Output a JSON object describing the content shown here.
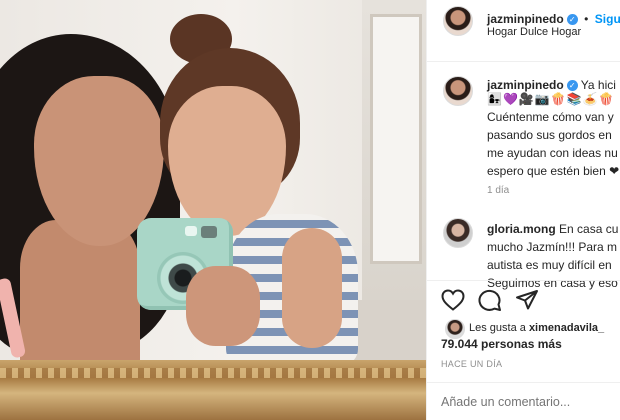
{
  "post": {
    "header": {
      "username": "jazminpinedo",
      "separator": "•",
      "follow_label": "Siguie",
      "location": "Hogar Dulce Hogar"
    },
    "caption": {
      "username": "jazminpinedo",
      "first_line_tail": "Ya hici",
      "emoji_line": "👩‍👧💜🎥📷🍿📚🍝🍿",
      "lines": [
        "Cuéntenme cómo van y",
        "pasando sus gordos en",
        "me ayudan con ideas nu",
        "espero que estén bien ❤"
      ],
      "time": "1 día"
    },
    "comment": {
      "username": "gloria.mong",
      "first_line_tail": "En casa cu",
      "lines": [
        "mucho Jazmín!!! Para m",
        "autista es muy difícil en",
        "Seguimos en casa y eso"
      ]
    },
    "likes": {
      "prefix": "Les gusta a",
      "liker": "ximenadavila_",
      "count_line": "79.044 personas más"
    },
    "posted_ago": "HACE UN DÍA",
    "add_comment_placeholder": "Añade un comentario..."
  },
  "icons": [
    "heart-icon",
    "comment-icon",
    "share-icon",
    "verified-badge-icon"
  ],
  "colors": {
    "link_blue": "#0095f6",
    "verified_blue": "#3897f0",
    "muted_gray": "#8e8e8e"
  }
}
